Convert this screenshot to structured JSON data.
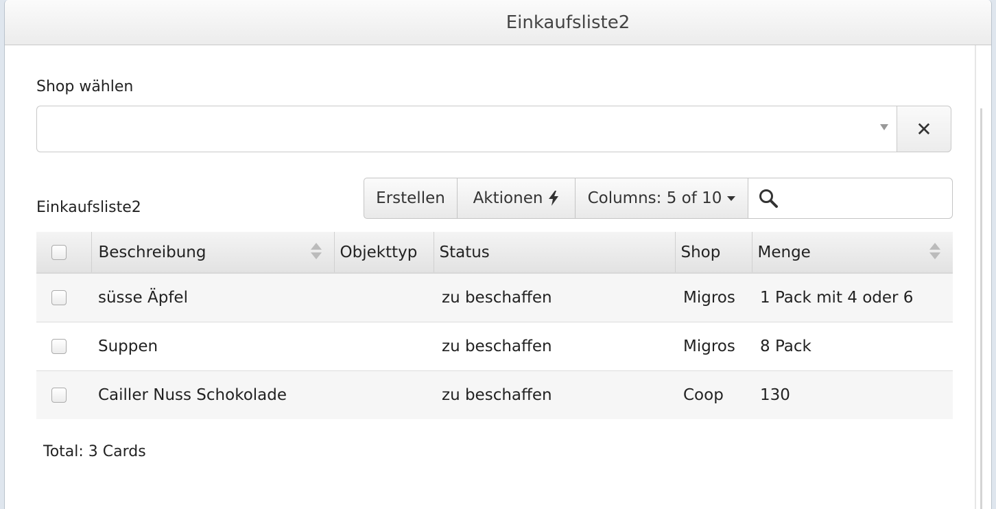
{
  "window": {
    "title": "Einkaufsliste2"
  },
  "shop_filter": {
    "label": "Shop wählen",
    "value": "",
    "clear_label": "✕"
  },
  "table_title": "Einkaufsliste2",
  "toolbar": {
    "create_label": "Erstellen",
    "actions_label": "Aktionen",
    "columns_label": "Columns: 5 of 10",
    "search_placeholder": "",
    "icons": {
      "actions": "bolt-icon",
      "search": "search-icon",
      "columns": "caret-down-icon"
    }
  },
  "table": {
    "headers": [
      "Beschreibung",
      "Objekttyp",
      "Status",
      "Shop",
      "Menge"
    ],
    "rows": [
      {
        "beschreibung": "süsse Äpfel",
        "objekttyp": "",
        "status": "zu beschaffen",
        "shop": "Migros",
        "menge": "1 Pack mit 4 oder 6"
      },
      {
        "beschreibung": "Suppen",
        "objekttyp": "",
        "status": "zu beschaffen",
        "shop": "Migros",
        "menge": "8 Pack"
      },
      {
        "beschreibung": "Cailler Nuss Schokolade",
        "objekttyp": "",
        "status": "zu beschaffen",
        "shop": "Coop",
        "menge": "130"
      }
    ]
  },
  "footer": {
    "total": "Total: 3 Cards"
  }
}
